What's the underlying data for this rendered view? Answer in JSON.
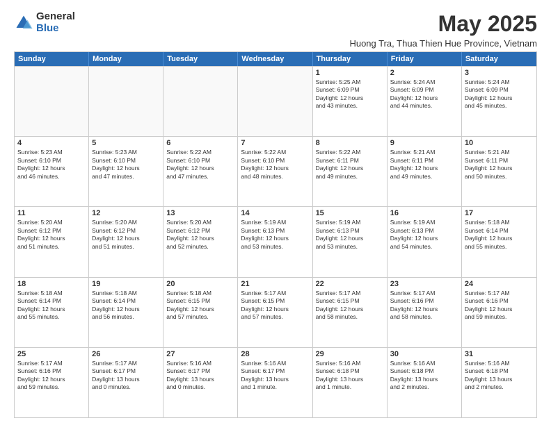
{
  "logo": {
    "general": "General",
    "blue": "Blue"
  },
  "title": "May 2025",
  "subtitle": "Huong Tra, Thua Thien Hue Province, Vietnam",
  "header_days": [
    "Sunday",
    "Monday",
    "Tuesday",
    "Wednesday",
    "Thursday",
    "Friday",
    "Saturday"
  ],
  "rows": [
    [
      {
        "day": "",
        "text": "",
        "empty": true
      },
      {
        "day": "",
        "text": "",
        "empty": true
      },
      {
        "day": "",
        "text": "",
        "empty": true
      },
      {
        "day": "",
        "text": "",
        "empty": true
      },
      {
        "day": "1",
        "text": "Sunrise: 5:25 AM\nSunset: 6:09 PM\nDaylight: 12 hours\nand 43 minutes.",
        "empty": false
      },
      {
        "day": "2",
        "text": "Sunrise: 5:24 AM\nSunset: 6:09 PM\nDaylight: 12 hours\nand 44 minutes.",
        "empty": false
      },
      {
        "day": "3",
        "text": "Sunrise: 5:24 AM\nSunset: 6:09 PM\nDaylight: 12 hours\nand 45 minutes.",
        "empty": false
      }
    ],
    [
      {
        "day": "4",
        "text": "Sunrise: 5:23 AM\nSunset: 6:10 PM\nDaylight: 12 hours\nand 46 minutes.",
        "empty": false
      },
      {
        "day": "5",
        "text": "Sunrise: 5:23 AM\nSunset: 6:10 PM\nDaylight: 12 hours\nand 47 minutes.",
        "empty": false
      },
      {
        "day": "6",
        "text": "Sunrise: 5:22 AM\nSunset: 6:10 PM\nDaylight: 12 hours\nand 47 minutes.",
        "empty": false
      },
      {
        "day": "7",
        "text": "Sunrise: 5:22 AM\nSunset: 6:10 PM\nDaylight: 12 hours\nand 48 minutes.",
        "empty": false
      },
      {
        "day": "8",
        "text": "Sunrise: 5:22 AM\nSunset: 6:11 PM\nDaylight: 12 hours\nand 49 minutes.",
        "empty": false
      },
      {
        "day": "9",
        "text": "Sunrise: 5:21 AM\nSunset: 6:11 PM\nDaylight: 12 hours\nand 49 minutes.",
        "empty": false
      },
      {
        "day": "10",
        "text": "Sunrise: 5:21 AM\nSunset: 6:11 PM\nDaylight: 12 hours\nand 50 minutes.",
        "empty": false
      }
    ],
    [
      {
        "day": "11",
        "text": "Sunrise: 5:20 AM\nSunset: 6:12 PM\nDaylight: 12 hours\nand 51 minutes.",
        "empty": false
      },
      {
        "day": "12",
        "text": "Sunrise: 5:20 AM\nSunset: 6:12 PM\nDaylight: 12 hours\nand 51 minutes.",
        "empty": false
      },
      {
        "day": "13",
        "text": "Sunrise: 5:20 AM\nSunset: 6:12 PM\nDaylight: 12 hours\nand 52 minutes.",
        "empty": false
      },
      {
        "day": "14",
        "text": "Sunrise: 5:19 AM\nSunset: 6:13 PM\nDaylight: 12 hours\nand 53 minutes.",
        "empty": false
      },
      {
        "day": "15",
        "text": "Sunrise: 5:19 AM\nSunset: 6:13 PM\nDaylight: 12 hours\nand 53 minutes.",
        "empty": false
      },
      {
        "day": "16",
        "text": "Sunrise: 5:19 AM\nSunset: 6:13 PM\nDaylight: 12 hours\nand 54 minutes.",
        "empty": false
      },
      {
        "day": "17",
        "text": "Sunrise: 5:18 AM\nSunset: 6:14 PM\nDaylight: 12 hours\nand 55 minutes.",
        "empty": false
      }
    ],
    [
      {
        "day": "18",
        "text": "Sunrise: 5:18 AM\nSunset: 6:14 PM\nDaylight: 12 hours\nand 55 minutes.",
        "empty": false
      },
      {
        "day": "19",
        "text": "Sunrise: 5:18 AM\nSunset: 6:14 PM\nDaylight: 12 hours\nand 56 minutes.",
        "empty": false
      },
      {
        "day": "20",
        "text": "Sunrise: 5:18 AM\nSunset: 6:15 PM\nDaylight: 12 hours\nand 57 minutes.",
        "empty": false
      },
      {
        "day": "21",
        "text": "Sunrise: 5:17 AM\nSunset: 6:15 PM\nDaylight: 12 hours\nand 57 minutes.",
        "empty": false
      },
      {
        "day": "22",
        "text": "Sunrise: 5:17 AM\nSunset: 6:15 PM\nDaylight: 12 hours\nand 58 minutes.",
        "empty": false
      },
      {
        "day": "23",
        "text": "Sunrise: 5:17 AM\nSunset: 6:16 PM\nDaylight: 12 hours\nand 58 minutes.",
        "empty": false
      },
      {
        "day": "24",
        "text": "Sunrise: 5:17 AM\nSunset: 6:16 PM\nDaylight: 12 hours\nand 59 minutes.",
        "empty": false
      }
    ],
    [
      {
        "day": "25",
        "text": "Sunrise: 5:17 AM\nSunset: 6:16 PM\nDaylight: 12 hours\nand 59 minutes.",
        "empty": false
      },
      {
        "day": "26",
        "text": "Sunrise: 5:17 AM\nSunset: 6:17 PM\nDaylight: 13 hours\nand 0 minutes.",
        "empty": false
      },
      {
        "day": "27",
        "text": "Sunrise: 5:16 AM\nSunset: 6:17 PM\nDaylight: 13 hours\nand 0 minutes.",
        "empty": false
      },
      {
        "day": "28",
        "text": "Sunrise: 5:16 AM\nSunset: 6:17 PM\nDaylight: 13 hours\nand 1 minute.",
        "empty": false
      },
      {
        "day": "29",
        "text": "Sunrise: 5:16 AM\nSunset: 6:18 PM\nDaylight: 13 hours\nand 1 minute.",
        "empty": false
      },
      {
        "day": "30",
        "text": "Sunrise: 5:16 AM\nSunset: 6:18 PM\nDaylight: 13 hours\nand 2 minutes.",
        "empty": false
      },
      {
        "day": "31",
        "text": "Sunrise: 5:16 AM\nSunset: 6:18 PM\nDaylight: 13 hours\nand 2 minutes.",
        "empty": false
      }
    ]
  ]
}
